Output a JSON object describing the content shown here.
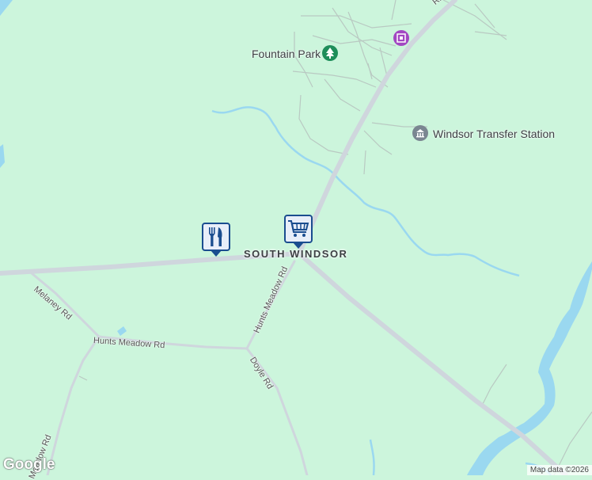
{
  "map": {
    "place_label": "SOUTH WINDSOR",
    "pois": {
      "park": "Fountain Park",
      "transfer": "Windsor Transfer Station"
    },
    "roads": {
      "ridge": "Ridg",
      "melaney": "Melaney Rd",
      "hunts_meadow_ns": "Hunts Meadow Rd",
      "hunts_meadow_ew": "Hunts Meadow Rd",
      "doyle": "Doyle Rd",
      "meadow_sw": "Meadow Rd"
    },
    "markers": {
      "restaurant": "restaurant-icon",
      "shopping": "shopping-cart-icon"
    },
    "colors": {
      "land": "#ccf5dc",
      "water": "#9ad8f0",
      "road": "#cfd6dd",
      "marker_border": "#1a4d8f"
    }
  },
  "footer": {
    "logo": "Google",
    "attribution": "Map data ©2026"
  }
}
